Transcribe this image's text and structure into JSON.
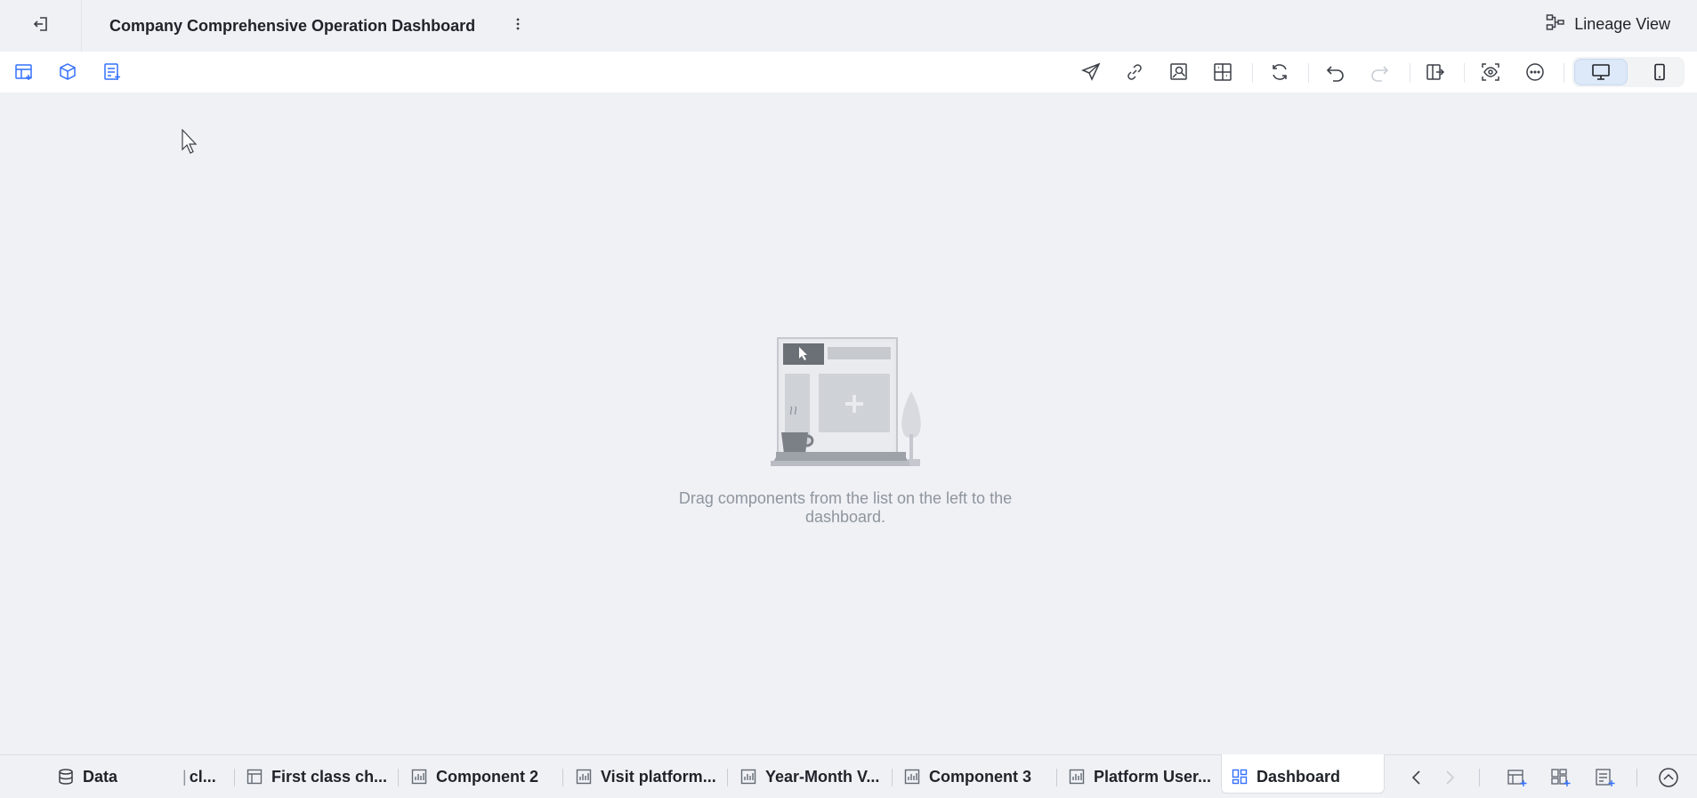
{
  "header": {
    "back_icon": "exit-icon",
    "title": "Company Comprehensive Operation Dashboard",
    "more_icon": "vertical-ellipsis-icon",
    "lineage_view_label": "Lineage View",
    "lineage_icon": "lineage-icon"
  },
  "toolbar": {
    "left_icons": [
      "add-chart-icon",
      "add-component-icon",
      "add-text-icon"
    ],
    "right_icons": [
      "send-icon",
      "link-icon",
      "image-search-icon",
      "layout-icon",
      "refresh-icon",
      "undo-icon",
      "redo-icon",
      "exit-panel-icon",
      "preview-icon",
      "more-icon"
    ],
    "device_modes": [
      "desktop-icon",
      "mobile-icon"
    ],
    "active_device": "desktop"
  },
  "canvas": {
    "empty_message": "Drag components from the list on the left to the dashboard."
  },
  "tabbar": {
    "tabs": [
      {
        "label": "Data",
        "icon": "database-icon"
      },
      {
        "label": "cl...",
        "icon": "chart-icon"
      },
      {
        "label": "First class ch...",
        "icon": "table-icon"
      },
      {
        "label": "Component 2",
        "icon": "chart-icon"
      },
      {
        "label": "Visit platform...",
        "icon": "chart-icon"
      },
      {
        "label": "Year-Month V...",
        "icon": "chart-icon"
      },
      {
        "label": "Component 3",
        "icon": "chart-icon"
      },
      {
        "label": "Platform User...",
        "icon": "chart-icon"
      },
      {
        "label": "Dashboard",
        "icon": "dashboard-icon"
      }
    ],
    "active_tab": "Dashboard",
    "right_icons": [
      "chevron-left-icon",
      "chevron-right-icon",
      "add-table-icon",
      "add-dashboard-icon",
      "add-sheet-icon",
      "collapse-up-icon"
    ]
  },
  "colors": {
    "accent": "#3370ff",
    "background": "#eff1f5",
    "text_primary": "#1f2329",
    "text_muted": "#8f959e"
  }
}
